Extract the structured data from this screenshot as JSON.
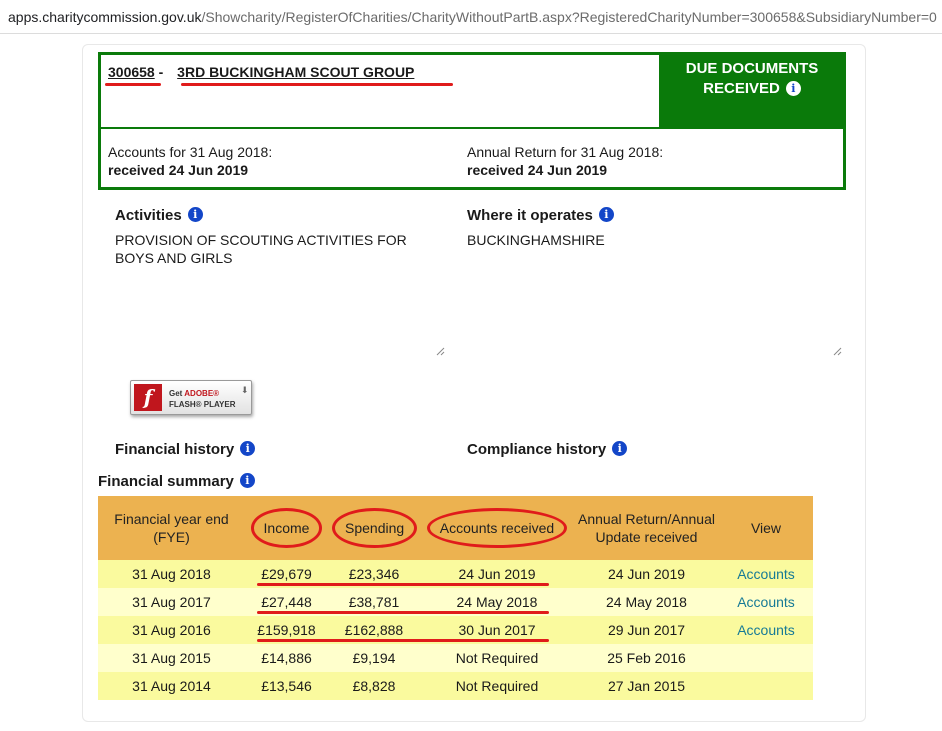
{
  "browser": {
    "url_domain": "apps.charitycommission.gov.uk",
    "url_path": "/Showcharity/RegisterOfCharities/CharityWithoutPartB.aspx?RegisteredCharityNumber=300658&SubsidiaryNumber=0"
  },
  "charity": {
    "number": "300658",
    "separator": " - ",
    "name": "3RD BUCKINGHAM SCOUT GROUP",
    "status_line1": "DUE DOCUMENTS",
    "status_line2": "RECEIVED",
    "accounts_label": "Accounts for 31 Aug 2018:",
    "accounts_received": "received 24 Jun 2019",
    "annual_return_label": "Annual Return for 31 Aug 2018:",
    "annual_return_received": "received 24 Jun 2019"
  },
  "activities": {
    "heading": "Activities",
    "text": "PROVISION OF SCOUTING ACTIVITIES FOR BOYS AND GIRLS"
  },
  "where_operates": {
    "heading": "Where it operates",
    "text": "BUCKINGHAMSHIRE"
  },
  "flash": {
    "get": "Get ",
    "adobe": "ADOBE®",
    "player": "FLASH® PLAYER",
    "logo_glyph": "f"
  },
  "financial_history": {
    "heading": "Financial history"
  },
  "compliance_history": {
    "heading": "Compliance history"
  },
  "financial_summary": {
    "heading": "Financial summary",
    "columns": [
      "Financial year end (FYE)",
      "Income",
      "Spending",
      "Accounts received",
      "Annual Return/Annual Update received",
      "View"
    ],
    "rows": [
      {
        "fye": "31 Aug 2018",
        "income": "£29,679",
        "spending": "£23,346",
        "accounts_received": "24 Jun 2019",
        "annual_return": "24 Jun 2019",
        "view": "Accounts"
      },
      {
        "fye": "31 Aug 2017",
        "income": "£27,448",
        "spending": "£38,781",
        "accounts_received": "24 May 2018",
        "annual_return": "24 May 2018",
        "view": "Accounts"
      },
      {
        "fye": "31 Aug 2016",
        "income": "£159,918",
        "spending": "£162,888",
        "accounts_received": "30 Jun 2017",
        "annual_return": "29 Jun 2017",
        "view": "Accounts"
      },
      {
        "fye": "31 Aug 2015",
        "income": "£14,886",
        "spending": "£9,194",
        "accounts_received": "Not Required",
        "annual_return": "25 Feb 2016",
        "view": ""
      },
      {
        "fye": "31 Aug 2014",
        "income": "£13,546",
        "spending": "£8,828",
        "accounts_received": "Not Required",
        "annual_return": "27 Jan 2015",
        "view": ""
      }
    ]
  },
  "colors": {
    "status_green": "#0a7a0a",
    "table_header": "#ecb250",
    "row_dark": "#fafa9e",
    "row_light": "#ffffcc",
    "annotation_red": "#e01b1b",
    "link": "#167a96"
  },
  "icons": [
    "info-icon",
    "flash-player-icon",
    "resize-handle-icon"
  ]
}
